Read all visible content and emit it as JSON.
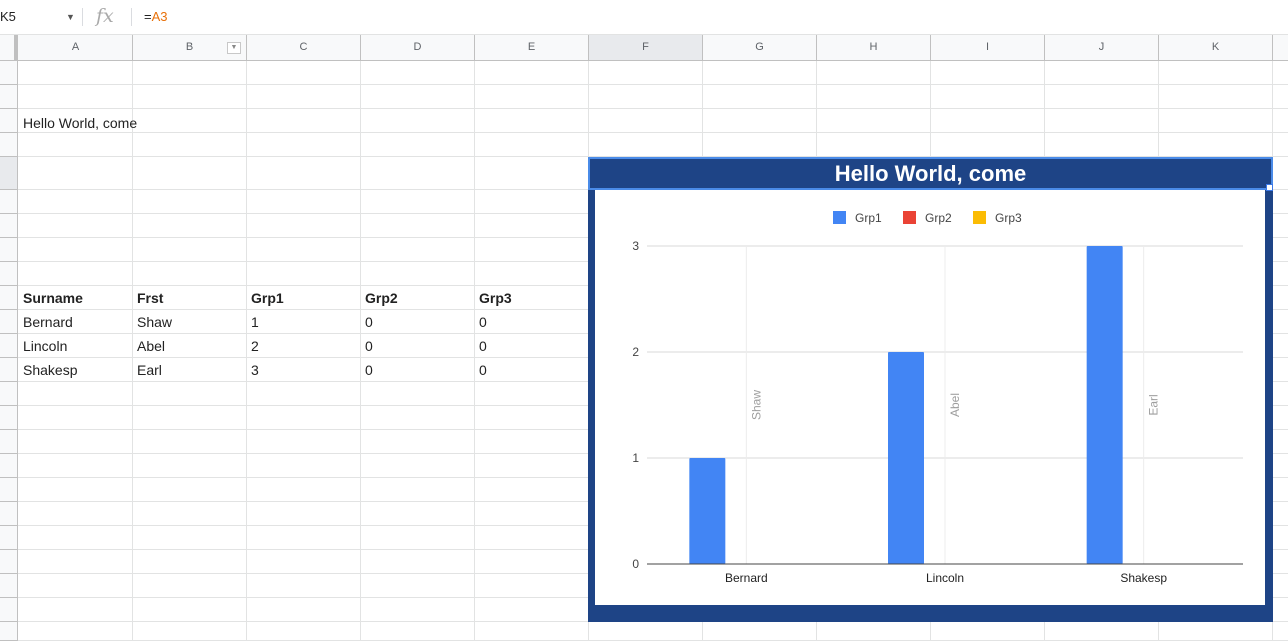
{
  "formula_bar": {
    "name_box": "K5",
    "fx": "fx",
    "formula_prefix": "=",
    "formula_ref": "A3"
  },
  "columns": [
    "A",
    "B",
    "C",
    "D",
    "E",
    "F",
    "G",
    "H",
    "I",
    "J",
    "K"
  ],
  "cells": {
    "A3": "Hello World, come",
    "headers": [
      "Surname",
      "Frst",
      "Grp1",
      "Grp2",
      "Grp3"
    ],
    "rows": [
      [
        "Bernard",
        "Shaw",
        "1",
        "0",
        "0"
      ],
      [
        "Lincoln",
        "Abel",
        "2",
        "0",
        "0"
      ],
      [
        "Shakesp",
        "Earl",
        "3",
        "0",
        "0"
      ]
    ]
  },
  "chart_data": {
    "type": "bar",
    "title": "Hello World, come",
    "categories": [
      "Bernard",
      "Lincoln",
      "Shakesp"
    ],
    "series": [
      {
        "name": "Grp1",
        "values": [
          1,
          2,
          3
        ],
        "color": "#4285f4"
      },
      {
        "name": "Grp2",
        "values": [
          0,
          0,
          0
        ],
        "color": "#ea4335"
      },
      {
        "name": "Grp3",
        "values": [
          0,
          0,
          0
        ],
        "color": "#fbbc04"
      }
    ],
    "annotations": [
      "Shaw",
      "Abel",
      "Earl"
    ],
    "yticks": [
      0,
      1,
      2,
      3
    ],
    "ylim": [
      0,
      3
    ],
    "legend": "top",
    "grid": true,
    "title_background": "#1e4486"
  }
}
